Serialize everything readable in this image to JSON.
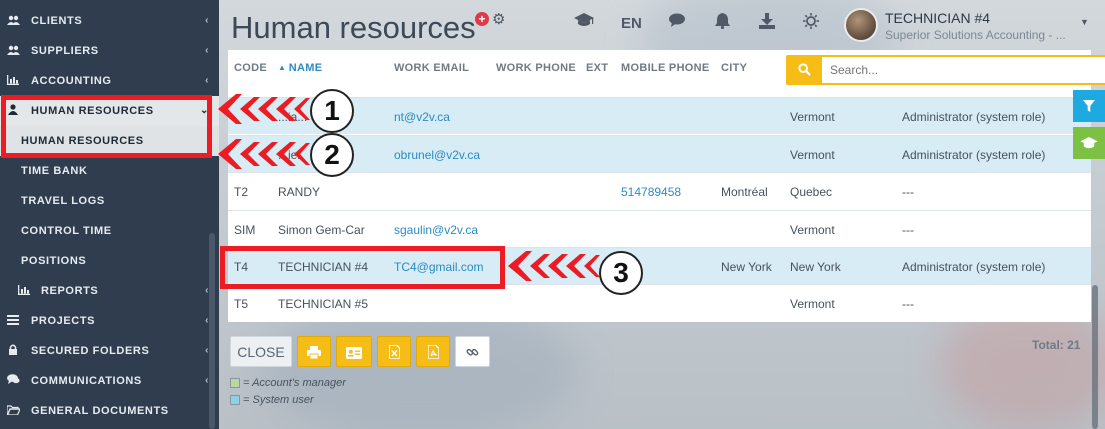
{
  "sidebar": {
    "items": [
      {
        "label": "CLIENTS",
        "icon": "users-icon"
      },
      {
        "label": "SUPPLIERS",
        "icon": "users-icon"
      },
      {
        "label": "ACCOUNTING",
        "icon": "bar-chart-icon"
      },
      {
        "label": "HUMAN RESOURCES",
        "icon": "user-icon",
        "active": true
      },
      {
        "label": "PROJECTS",
        "icon": "list-icon"
      },
      {
        "label": "SECURED FOLDERS",
        "icon": "lock-icon"
      },
      {
        "label": "COMMUNICATIONS",
        "icon": "chat-icon"
      },
      {
        "label": "GENERAL DOCUMENTS",
        "icon": "folder-open-icon"
      }
    ],
    "subitems": [
      {
        "label": "HUMAN RESOURCES",
        "active": true
      },
      {
        "label": "TIME BANK"
      },
      {
        "label": "TRAVEL LOGS"
      },
      {
        "label": "CONTROL TIME"
      },
      {
        "label": "POSITIONS"
      },
      {
        "label": "REPORTS",
        "icon": "bar-chart-icon"
      }
    ]
  },
  "header": {
    "title": "Human resources",
    "add_label": "+",
    "language": "EN",
    "user_name": "TECHNICIAN #4",
    "user_company": "Superior Solutions Accounting - ..."
  },
  "table": {
    "columns": [
      "CODE",
      "NAME",
      "WORK EMAIL",
      "WORK PHONE",
      "EXT",
      "MOBILE PHONE",
      "CITY"
    ],
    "sorted_column": "NAME",
    "search_placeholder": "Search...",
    "rows": [
      {
        "code": "",
        "name": "...ia...",
        "email": "nt@v2v.ca",
        "mobile": "",
        "city": "",
        "province": "Vermont",
        "role": "Administrator (system role)",
        "system_user": true
      },
      {
        "code": "",
        "name": "...ier",
        "email": "obrunel@v2v.ca",
        "mobile": "",
        "city": "",
        "province": "Vermont",
        "role": "Administrator (system role)",
        "system_user": true
      },
      {
        "code": "T2",
        "name": "RANDY",
        "email": "",
        "mobile": "514789458",
        "city": "Montréal",
        "province": "Quebec",
        "role": "---",
        "system_user": false
      },
      {
        "code": "SIM",
        "name": "Simon Gem-Car",
        "email": "sgaulin@v2v.ca",
        "mobile": "",
        "city": "",
        "province": "Vermont",
        "role": "---",
        "system_user": false
      },
      {
        "code": "T4",
        "name": "TECHNICIAN #4",
        "email": "TC4@gmail.com",
        "mobile": "",
        "city": "New York",
        "province": "New York",
        "role": "Administrator (system role)",
        "system_user": true
      },
      {
        "code": "T5",
        "name": "TECHNICIAN #5",
        "email": "",
        "mobile": "",
        "city": "",
        "province": "Vermont",
        "role": "---",
        "system_user": false
      }
    ]
  },
  "footer": {
    "close_label": "CLOSE",
    "legend_manager": "= Account's manager",
    "legend_system": "= System user",
    "total": "Total: 21"
  },
  "annotations": [
    "1",
    "2",
    "3"
  ],
  "colors": {
    "sidebar": "#2f3d4e",
    "accent_yellow": "#f6bd16",
    "link_blue": "#2c8bc3",
    "system_row": "#d7ecf5",
    "annotation_red": "#ec1c24"
  }
}
